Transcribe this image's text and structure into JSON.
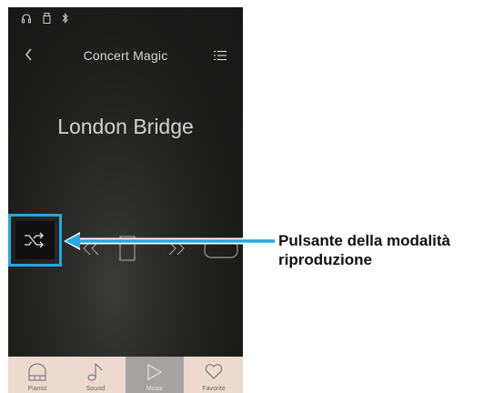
{
  "app": {
    "title": "Concert Magic",
    "song_title": "London Bridge"
  },
  "status_bar": {
    "icons": [
      "headphones-icon",
      "usb-icon",
      "bluetooth-icon"
    ]
  },
  "controls": {
    "items": [
      "shuffle-icon",
      "rewind-icon",
      "stop-icon",
      "fast-forward-icon",
      "repeat-icon"
    ]
  },
  "tabs": [
    {
      "label": "Pianist",
      "icon": "piano-icon",
      "active": false
    },
    {
      "label": "Sound",
      "icon": "note-icon",
      "active": false
    },
    {
      "label": "Music",
      "icon": "play-icon",
      "active": true
    },
    {
      "label": "Favorite",
      "icon": "heart-icon",
      "active": false
    }
  ],
  "callout": {
    "line1": "Pulsante della modalità",
    "line2": "riproduzione"
  },
  "colors": {
    "highlight": "#23a8e0",
    "tab_bar": "#ecdad0",
    "tab_active": "#a6a3a3"
  }
}
